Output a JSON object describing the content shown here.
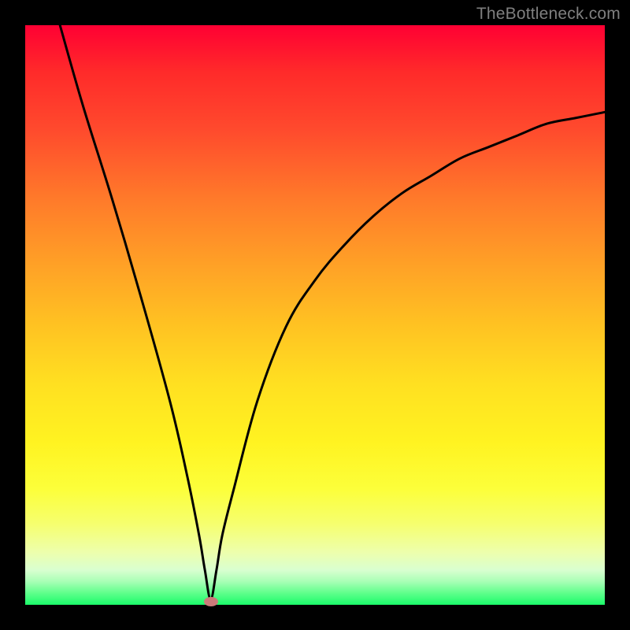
{
  "watermark": "TheBottleneck.com",
  "chart_data": {
    "type": "line",
    "title": "",
    "xlabel": "",
    "ylabel": "",
    "xlim": [
      0,
      100
    ],
    "ylim": [
      0,
      100
    ],
    "grid": false,
    "legend": false,
    "series": [
      {
        "name": "curve",
        "x": [
          6,
          10,
          15,
          20,
          25,
          28,
          30,
          31,
          32,
          33,
          34,
          36,
          40,
          45,
          50,
          55,
          60,
          65,
          70,
          75,
          80,
          85,
          90,
          95,
          100
        ],
        "y": [
          100,
          86,
          70,
          53,
          35,
          22,
          12,
          6,
          1,
          6,
          12,
          20,
          35,
          48,
          56,
          62,
          67,
          71,
          74,
          77,
          79,
          81,
          83,
          84,
          85
        ]
      }
    ],
    "marker": {
      "x": 32,
      "y": 0.5,
      "color": "#cc7a7a"
    },
    "gradient_stops": [
      {
        "pos": 0,
        "color": "#ff0033"
      },
      {
        "pos": 50,
        "color": "#ffc322"
      },
      {
        "pos": 80,
        "color": "#fcff3a"
      },
      {
        "pos": 100,
        "color": "#1bfb6a"
      }
    ]
  }
}
